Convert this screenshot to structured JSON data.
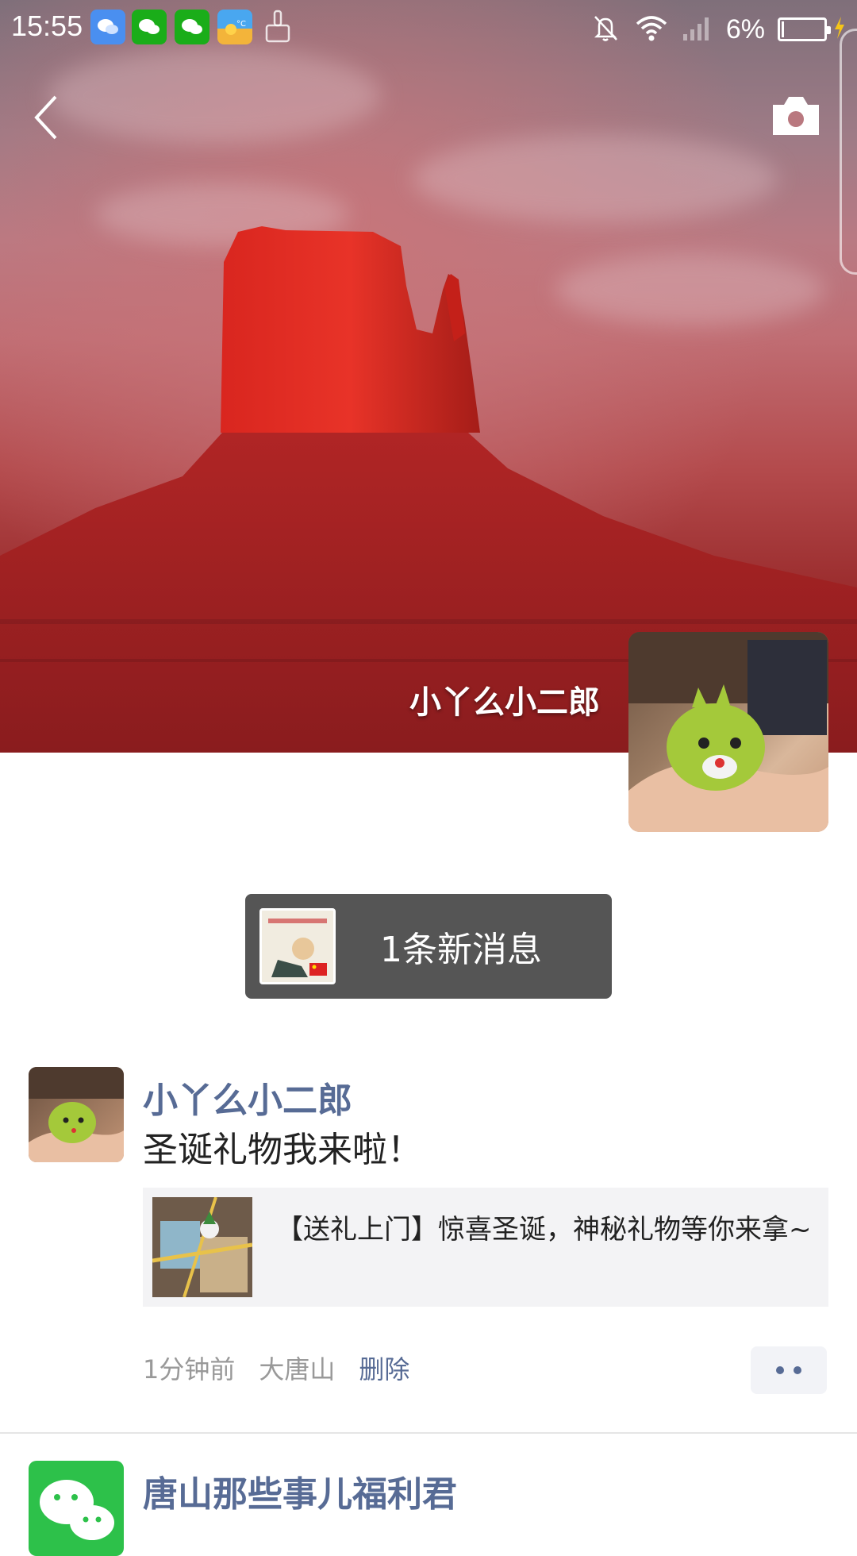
{
  "status_bar": {
    "time": "15:55",
    "battery_text": "6%",
    "battery_level": 0.06,
    "apps": [
      "chat-notification-icon",
      "wechat-icon",
      "wechat-icon",
      "weather-icon",
      "cleaner-icon"
    ],
    "indicators": [
      "mute-icon",
      "wifi-icon",
      "signal-icon",
      "battery-icon",
      "charging-icon"
    ]
  },
  "profile": {
    "name": "小丫么小二郎"
  },
  "notification": {
    "text": "1条新消息"
  },
  "posts": [
    {
      "author": "小丫么小二郎",
      "text": "圣诞礼物我来啦！",
      "link_title": "【送礼上门】惊喜圣诞，神秘礼物等你来拿~",
      "time": "1分钟前",
      "location": "大唐山",
      "delete_label": "删除"
    },
    {
      "author": "唐山那些事儿福利君"
    }
  ],
  "colors": {
    "link_blue": "#576b95",
    "pill_bg": "#555555"
  }
}
